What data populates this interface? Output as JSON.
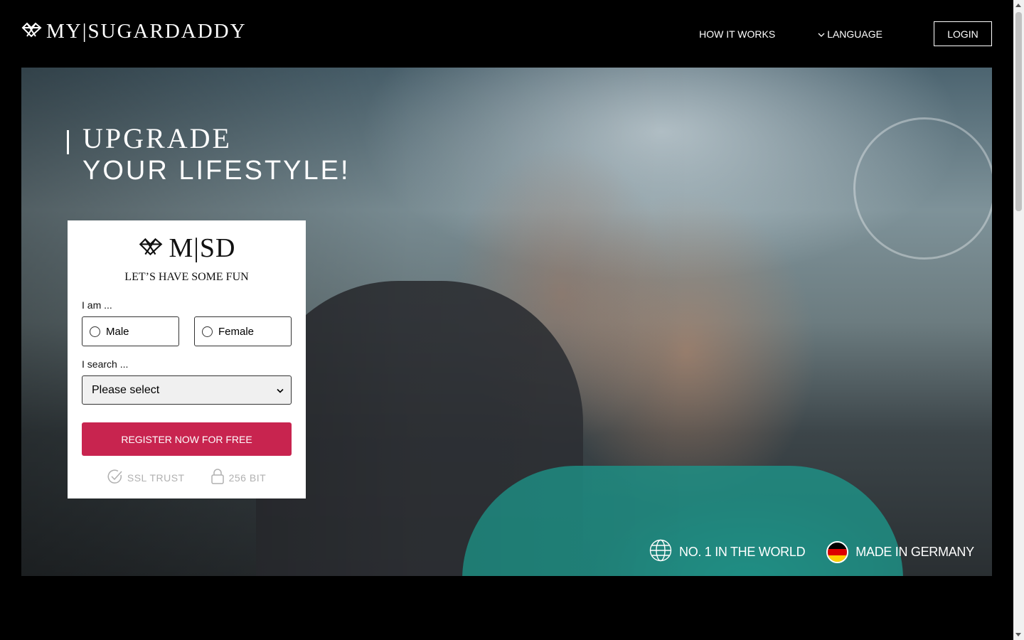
{
  "header": {
    "logo_text": "MY|SUGARDADDY",
    "nav": {
      "how_it_works": "HOW IT WORKS",
      "language": "LANGUAGE",
      "login": "LOGIN"
    }
  },
  "hero": {
    "headline_line1": "UPGRADE",
    "headline_line2": "YOUR LIFESTYLE!"
  },
  "form": {
    "logo_text": "M|SD",
    "tagline": "LET’S HAVE SOME FUN",
    "i_am_label": "I am ...",
    "gender_options": [
      "Male",
      "Female"
    ],
    "i_search_label": "I search ...",
    "search_select_value": "Please select",
    "register_button": "REGISTER NOW FOR FREE",
    "trust": {
      "ssl": "SSL TRUST",
      "bit": "256 BIT"
    }
  },
  "badges": {
    "world": "NO. 1 IN THE WORLD",
    "germany": "MADE IN GERMANY"
  },
  "colors": {
    "accent": "#c8244f",
    "background": "#000000",
    "card": "#ffffff"
  },
  "icons": [
    "diamond-logo-icon",
    "chevron-down-icon",
    "check-circle-icon",
    "lock-icon",
    "globe-icon",
    "germany-flag-icon"
  ]
}
